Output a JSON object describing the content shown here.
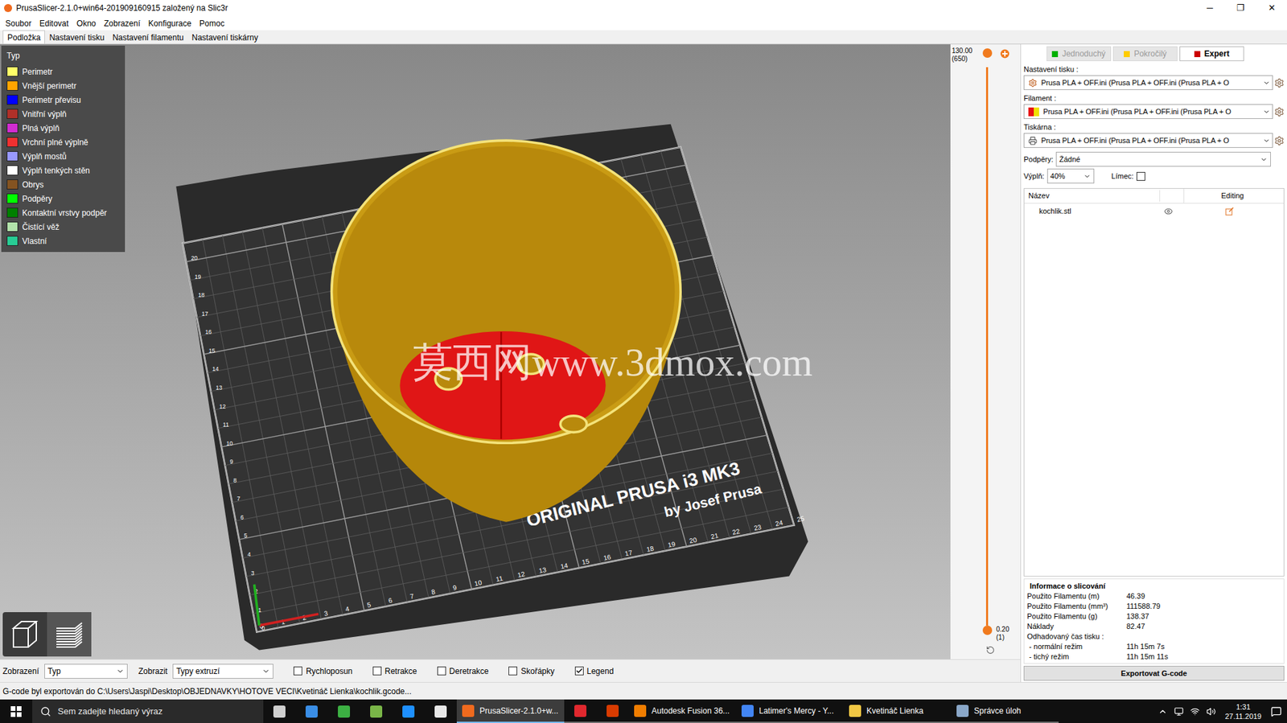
{
  "window": {
    "title": "PrusaSlicer-2.1.0+win64-201909160915 založený na Slic3r",
    "controls": [
      "─",
      "❐",
      "✕"
    ]
  },
  "menu": [
    "Soubor",
    "Editovat",
    "Okno",
    "Zobrazení",
    "Konfigurace",
    "Pomoc"
  ],
  "tabs": [
    {
      "label": "Podložka",
      "selected": true
    },
    {
      "label": "Nastavení tisku",
      "selected": false
    },
    {
      "label": "Nastavení filamentu",
      "selected": false
    },
    {
      "label": "Nastavení tiskárny",
      "selected": false
    }
  ],
  "legend": {
    "title": "Typ",
    "items": [
      {
        "label": "Perimetr",
        "color": "#ffff68"
      },
      {
        "label": "Vnější perimetr",
        "color": "#ffa500"
      },
      {
        "label": "Perimetr převisu",
        "color": "#0000ff"
      },
      {
        "label": "Vnitřní výplň",
        "color": "#b03029"
      },
      {
        "label": "Plná výplň",
        "color": "#d22cd2"
      },
      {
        "label": "Vrchní plné výplně",
        "color": "#f03030"
      },
      {
        "label": "Výplň mostů",
        "color": "#9999ff"
      },
      {
        "label": "Výplň tenkých stěn",
        "color": "#ffffff"
      },
      {
        "label": "Obrys",
        "color": "#845321"
      },
      {
        "label": "Podpěry",
        "color": "#00ff00"
      },
      {
        "label": "Kontaktní vrstvy podpěr",
        "color": "#008000"
      },
      {
        "label": "Čistící věž",
        "color": "#b3e3ab"
      },
      {
        "label": "Vlastní",
        "color": "#28cc94"
      }
    ]
  },
  "bed": {
    "label": "ORIGINAL PRUSA i3 MK3",
    "sublabel": "by Josef Prusa",
    "x_ticks": [
      "0",
      "1",
      "2",
      "3",
      "4",
      "5",
      "6",
      "7",
      "8",
      "9",
      "10",
      "11",
      "12",
      "13",
      "14",
      "15",
      "16",
      "17",
      "18",
      "19",
      "20",
      "21",
      "22",
      "23",
      "24",
      "25"
    ],
    "y_ticks": [
      "0",
      "1",
      "2",
      "3",
      "4",
      "5",
      "6",
      "7",
      "8",
      "9",
      "10",
      "11",
      "12",
      "13",
      "14",
      "15",
      "16",
      "17",
      "18",
      "19",
      "20"
    ]
  },
  "watermark": "莫西网www.3dmox.com",
  "slider": {
    "top": "130.00",
    "top_sub": "(650)",
    "bottom": "0.20",
    "bottom_sub": "(1)",
    "upper": 1,
    "lower": 0
  },
  "view_toolbar": {
    "view_label": "Zobrazení",
    "view_value": "Typ",
    "show_label": "Zobrazit",
    "show_value": "Typy extruzí",
    "checkboxes": [
      {
        "label": "Rychloposun",
        "checked": false
      },
      {
        "label": "Retrakce",
        "checked": false
      },
      {
        "label": "Deretrakce",
        "checked": false
      },
      {
        "label": "Skořápky",
        "checked": false
      },
      {
        "label": "Legend",
        "checked": true
      }
    ]
  },
  "mode_buttons": [
    {
      "label": "Jednoduchý",
      "selected": false,
      "color": "#00b000"
    },
    {
      "label": "Pokročilý",
      "selected": false,
      "color": "#ffcc00"
    },
    {
      "label": "Expert",
      "selected": true,
      "color": "#cc0000"
    }
  ],
  "presets": [
    {
      "kind": "print",
      "label": "Nastavení tisku :",
      "value": "Prusa PLA + OFF.ini (Prusa PLA + OFF.ini (Prusa PLA + O"
    },
    {
      "kind": "filament",
      "label": "Filament :",
      "value": "Prusa PLA + OFF.ini (Prusa PLA + OFF.ini (Prusa PLA + O",
      "swatch": [
        "#e81010",
        "#f0e000"
      ]
    },
    {
      "kind": "printer",
      "label": "Tiskárna :",
      "value": "Prusa PLA + OFF.ini (Prusa PLA + OFF.ini (Prusa PLA + O"
    }
  ],
  "supports": {
    "label": "Podpěry:",
    "value": "Žádné"
  },
  "infill": {
    "label": "Výplň:",
    "value": "40%"
  },
  "brim": {
    "label": "Límec:",
    "checked": false
  },
  "objects": {
    "columns": [
      "Název",
      "Editing"
    ],
    "rows": [
      {
        "name": "kochlik.stl",
        "visible": true
      }
    ]
  },
  "slice_info": {
    "title": "Informace o slicování",
    "rows": [
      {
        "label": "Použito Filamentu (m)",
        "value": "46.39"
      },
      {
        "label": "Použito Filamentu (mm³)",
        "value": "111588.79"
      },
      {
        "label": "Použito Filamentu (g)",
        "value": "138.37"
      },
      {
        "label": "Náklady",
        "value": "82.47"
      },
      {
        "label": "Odhadovaný čas tisku :",
        "value": ""
      },
      {
        "label": " - normální režim",
        "value": "11h 15m 7s"
      },
      {
        "label": " - tichý režim",
        "value": "11h 15m 11s"
      }
    ]
  },
  "export_button": "Exportovat G-code",
  "status_bar": "G-code byl exportován do C:\\Users\\Jaspi\\Desktop\\OBJEDNAVKY\\HOTOVE VECI\\Kvetináč Lienka\\kochlik.gcode...",
  "taskbar": {
    "search": "Sem zadejte hledaný výraz",
    "pinned": [
      {
        "color": "#d0d0d0"
      },
      {
        "color": "#3a8ee6"
      },
      {
        "color": "#3cb043"
      },
      {
        "color": "#7ab648"
      },
      {
        "color": "#1e90ff"
      },
      {
        "color": "#e8e8e8"
      }
    ],
    "apps": [
      {
        "label": "PrusaSlicer-2.1.0+w...",
        "active": true,
        "color": "#f06a1e"
      },
      {
        "label": "",
        "active": false,
        "color": "#e0282e"
      },
      {
        "label": "",
        "active": false,
        "color": "#d83b01"
      },
      {
        "label": "Autodesk Fusion 36...",
        "active": false,
        "color": "#f07d00"
      },
      {
        "label": "Latimer's Mercy - Y...",
        "active": false,
        "color": "#4285f4"
      },
      {
        "label": "Kvetináč Lienka",
        "active": false,
        "color": "#f2c744"
      },
      {
        "label": "Správce úloh",
        "active": false,
        "color": "#8aa7c8"
      }
    ],
    "time": "1:31",
    "date": "27.11.2019"
  }
}
